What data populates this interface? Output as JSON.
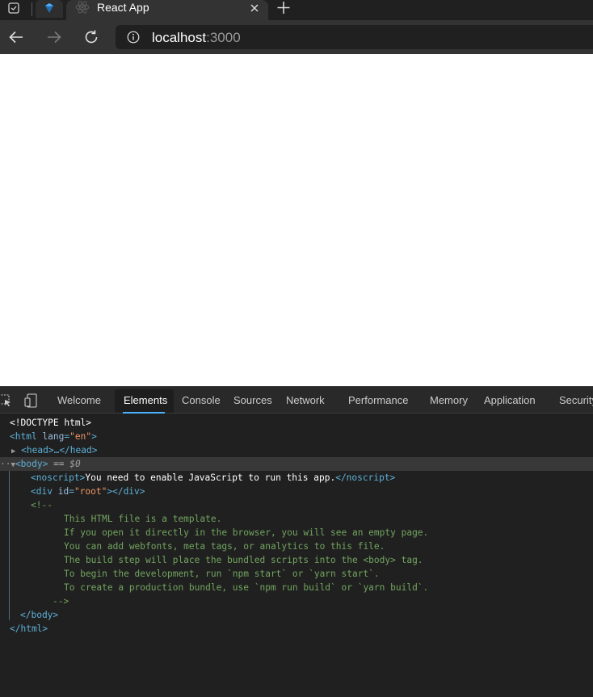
{
  "browser": {
    "tab_title": "React App",
    "url_host": "localhost",
    "url_port": ":3000",
    "icons": {
      "window": "window-menu-icon",
      "pinned": "pinned-tab-icon",
      "favicon": "react-icon",
      "close": "close-icon",
      "new_tab": "plus-icon",
      "back": "back-arrow-icon",
      "forward": "forward-arrow-icon",
      "reload": "reload-icon",
      "info": "info-icon"
    }
  },
  "devtools": {
    "tabs": [
      "Welcome",
      "Elements",
      "Console",
      "Sources",
      "Network",
      "Performance",
      "Memory",
      "Application",
      "Security"
    ],
    "active_tab": "Elements",
    "accent_color": "#4db3ff",
    "dom": {
      "doctype": "<!DOCTYPE html>",
      "html_open_tag": "<html",
      "html_lang_attr": "lang",
      "html_lang_value": "\"en\"",
      "html_open_close": ">",
      "head_collapsed": "<head>…</head>",
      "body_open": "<body>",
      "body_selected_marker": " == ",
      "body_selected_var": "$0",
      "noscript_open": "<noscript>",
      "noscript_text": "You need to enable JavaScript to run this app.",
      "noscript_close": "</noscript>",
      "div_open": "<div",
      "div_id_attr": "id",
      "div_id_value": "\"root\"",
      "div_close": "></div>",
      "comment_open": "<!--",
      "comment_lines": [
        "This HTML file is a template.",
        "If you open it directly in the browser, you will see an empty page.",
        "You can add webfonts, meta tags, or analytics to this file.",
        "The build step will place the bundled scripts into the <body> tag.",
        "To begin the development, run `npm start` or `yarn start`.",
        "To create a production bundle, use `npm run build` or `yarn build`."
      ],
      "comment_close": "-->",
      "body_close": "</body>",
      "html_close": "</html>"
    }
  }
}
